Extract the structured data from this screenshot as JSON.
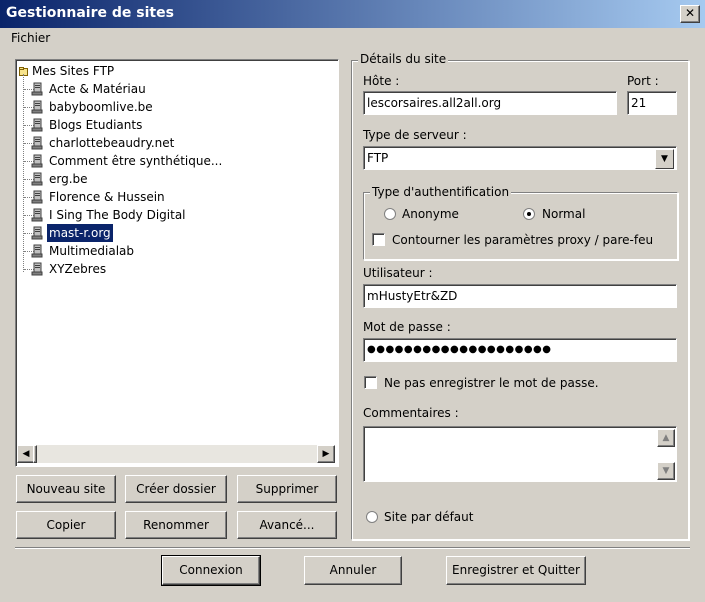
{
  "window": {
    "title": "Gestionnaire de sites",
    "close_glyph": "✕"
  },
  "menu": {
    "file": "Fichier"
  },
  "tree": {
    "root": "Mes Sites FTP",
    "items": [
      "Acte & Matériau",
      "babyboomlive.be",
      "Blogs Etudiants",
      "charlottebeaudry.net",
      "Comment être synthétique...",
      "erg.be",
      "Florence & Hussein",
      "I Sing The Body Digital",
      "mast-r.org",
      "Multimedialab",
      "XYZebres"
    ],
    "selected_index": 8
  },
  "tree_buttons": {
    "new_site": "Nouveau site",
    "new_folder": "Créer dossier",
    "delete": "Supprimer",
    "copy": "Copier",
    "rename": "Renommer",
    "advanced": "Avancé..."
  },
  "details": {
    "group_label": "Détails du site",
    "host_label": "Hôte :",
    "host_value": "lescorsaires.all2all.org",
    "port_label": "Port :",
    "port_value": "21",
    "server_type_label": "Type de serveur :",
    "server_type_value": "FTP",
    "auth_group_label": "Type d'authentification",
    "auth_anonymous": "Anonyme",
    "auth_normal": "Normal",
    "auth_selected": "Normal",
    "bypass_proxy": "Contourner les paramètres proxy / pare-feu",
    "bypass_proxy_checked": false,
    "user_label": "Utilisateur :",
    "user_value": "mHustyEtr&ZD",
    "password_label": "Mot de passe :",
    "password_value": "●●●●●●●●●●●●●●●●●●●●",
    "no_save_password": "Ne pas enregistrer le mot de passe.",
    "no_save_password_checked": false,
    "comments_label": "Commentaires :",
    "comments_value": "",
    "default_site": "Site par défaut",
    "default_site_checked": false
  },
  "footer": {
    "connect": "Connexion",
    "cancel": "Annuler",
    "save_quit": "Enregistrer et Quitter"
  }
}
